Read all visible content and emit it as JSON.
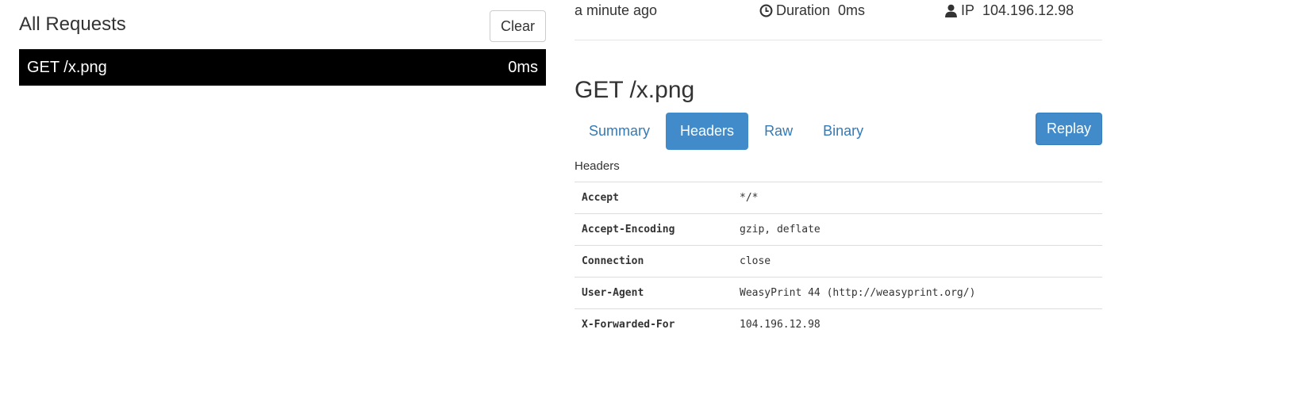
{
  "left": {
    "title": "All Requests",
    "clear_label": "Clear",
    "requests": [
      {
        "label": "GET /x.png",
        "duration": "0ms"
      }
    ]
  },
  "meta": {
    "time": "a minute ago",
    "duration_label": "Duration",
    "duration_value": "0ms",
    "ip_label": "IP",
    "ip_value": "104.196.12.98",
    "icons": {
      "duration": "clock-icon",
      "ip": "user-icon"
    }
  },
  "request": {
    "title": "GET /x.png"
  },
  "tabs": [
    {
      "label": "Summary",
      "active": false
    },
    {
      "label": "Headers",
      "active": true
    },
    {
      "label": "Raw",
      "active": false
    },
    {
      "label": "Binary",
      "active": false
    }
  ],
  "replay_label": "Replay",
  "headers_section": {
    "label": "Headers",
    "rows": [
      {
        "name": "Accept",
        "value": "*/*"
      },
      {
        "name": "Accept-Encoding",
        "value": "gzip, deflate"
      },
      {
        "name": "Connection",
        "value": "close"
      },
      {
        "name": "User-Agent",
        "value": "WeasyPrint 44 (http://weasyprint.org/)"
      },
      {
        "name": "X-Forwarded-For",
        "value": "104.196.12.98"
      }
    ]
  },
  "colors": {
    "accent": "#428bca",
    "link": "#337ab7",
    "selected_row_bg": "#000000"
  }
}
